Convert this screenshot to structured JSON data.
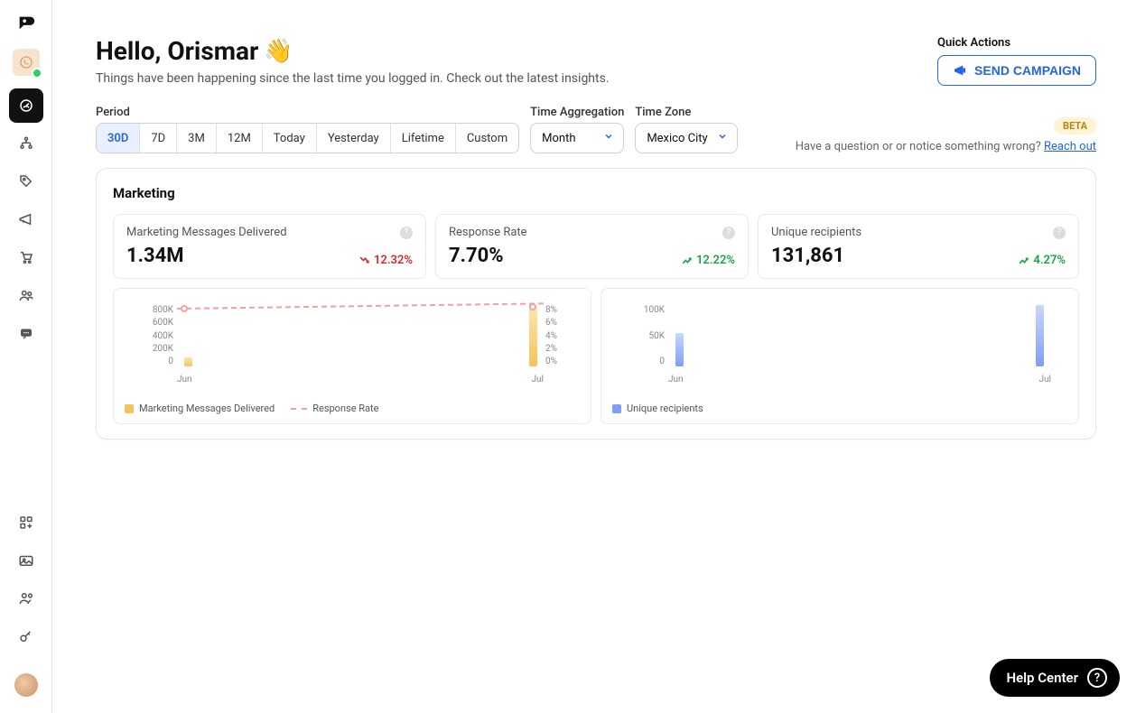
{
  "greeting": {
    "title": "Hello, Orismar",
    "wave": "👋",
    "subtitle": "Things have been happening since the last time you logged in. Check out the latest insights."
  },
  "quick_actions": {
    "label": "Quick Actions",
    "send_campaign": "SEND CAMPAIGN"
  },
  "controls": {
    "period_label": "Period",
    "periods": [
      "30D",
      "7D",
      "3M",
      "12M",
      "Today",
      "Yesterday",
      "Lifetime",
      "Custom"
    ],
    "period_active": "30D",
    "agg_label": "Time Aggregation",
    "agg_value": "Month",
    "tz_label": "Time Zone",
    "tz_value": "Mexico City"
  },
  "feedback": {
    "beta": "BETA",
    "question": "Have a question or or notice something wrong?",
    "reach_out": "Reach out"
  },
  "marketing": {
    "title": "Marketing",
    "kpis": [
      {
        "label": "Marketing Messages Delivered",
        "value": "1.34M",
        "delta": "12.32%",
        "dir": "down"
      },
      {
        "label": "Response Rate",
        "value": "7.70%",
        "delta": "12.22%",
        "dir": "up"
      },
      {
        "label": "Unique recipients",
        "value": "131,861",
        "delta": "4.27%",
        "dir": "up"
      }
    ]
  },
  "chart_data": [
    {
      "type": "bar",
      "title": "",
      "categories": [
        "Jun",
        "Jul"
      ],
      "series": [
        {
          "name": "Marketing Messages Delivered",
          "values": [
            120000,
            800000
          ],
          "axis": "y"
        },
        {
          "name": "Response Rate",
          "values": [
            7.6,
            7.8
          ],
          "axis": "y2",
          "style": "dashed"
        }
      ],
      "yticks": [
        "800K",
        "600K",
        "400K",
        "200K",
        "0"
      ],
      "y2ticks": [
        "8%",
        "6%",
        "4%",
        "2%",
        "0%"
      ],
      "ylim": [
        0,
        800000
      ],
      "y2lim": [
        0,
        8
      ],
      "xticks": [
        "Jun",
        "Jul"
      ]
    },
    {
      "type": "bar",
      "title": "",
      "categories": [
        "Jun",
        "Jul"
      ],
      "series": [
        {
          "name": "Unique recipients",
          "values": [
            55000,
            100000
          ]
        }
      ],
      "yticks": [
        "100K",
        "50K",
        "0"
      ],
      "ylim": [
        0,
        100000
      ],
      "xticks": [
        "Jun",
        "Jul"
      ]
    }
  ],
  "legends": {
    "chart1_a": "Marketing Messages Delivered",
    "chart1_b": "Response Rate",
    "chart2": "Unique recipients"
  },
  "help_center": "Help Center"
}
